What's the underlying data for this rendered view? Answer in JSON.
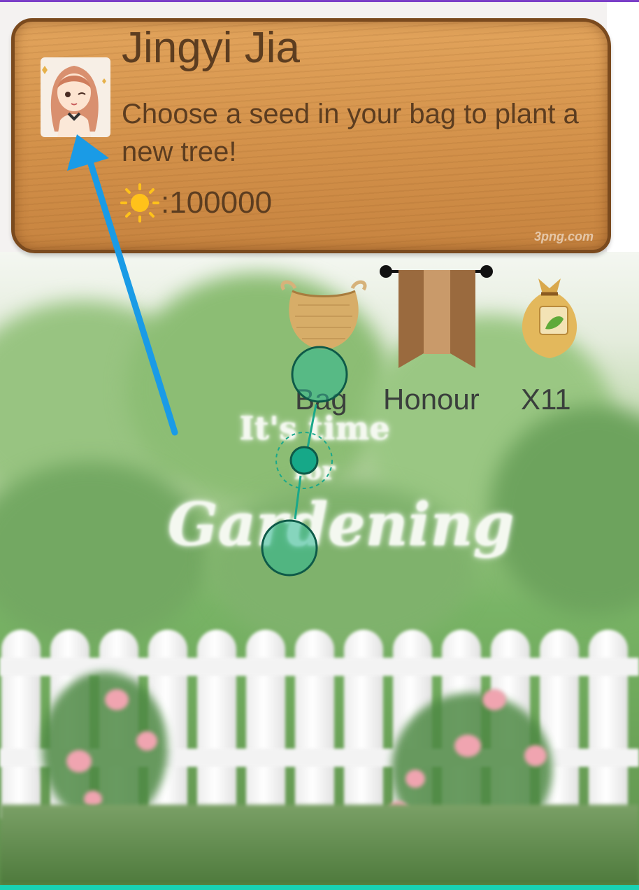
{
  "header": {
    "user_name": "Jingyi Jia",
    "prompt": "Choose a seed in your bag to plant a new tree!",
    "sun_separator": ": ",
    "sun_amount": "100000",
    "watermark": "3png.com"
  },
  "toolbar": {
    "bag_label": "Bag",
    "honour_label": "Honour",
    "seed_count_label": "X11"
  },
  "background": {
    "line1": "It's time",
    "line2": "for",
    "line3": "Gardening"
  },
  "icons": {
    "avatar": "girl-avatar",
    "sun": "sun-icon",
    "bag": "basket-bag-icon",
    "honour": "ribbon-banner-icon",
    "seed": "seed-sack-icon"
  },
  "colors": {
    "wood": "#d3914a",
    "text_brown": "#5c3d20",
    "accent_top": "#7b3fc8",
    "accent_bottom": "#19d3b4",
    "gesture_teal": "#1aa88a",
    "arrow_blue": "#1a9be6"
  }
}
